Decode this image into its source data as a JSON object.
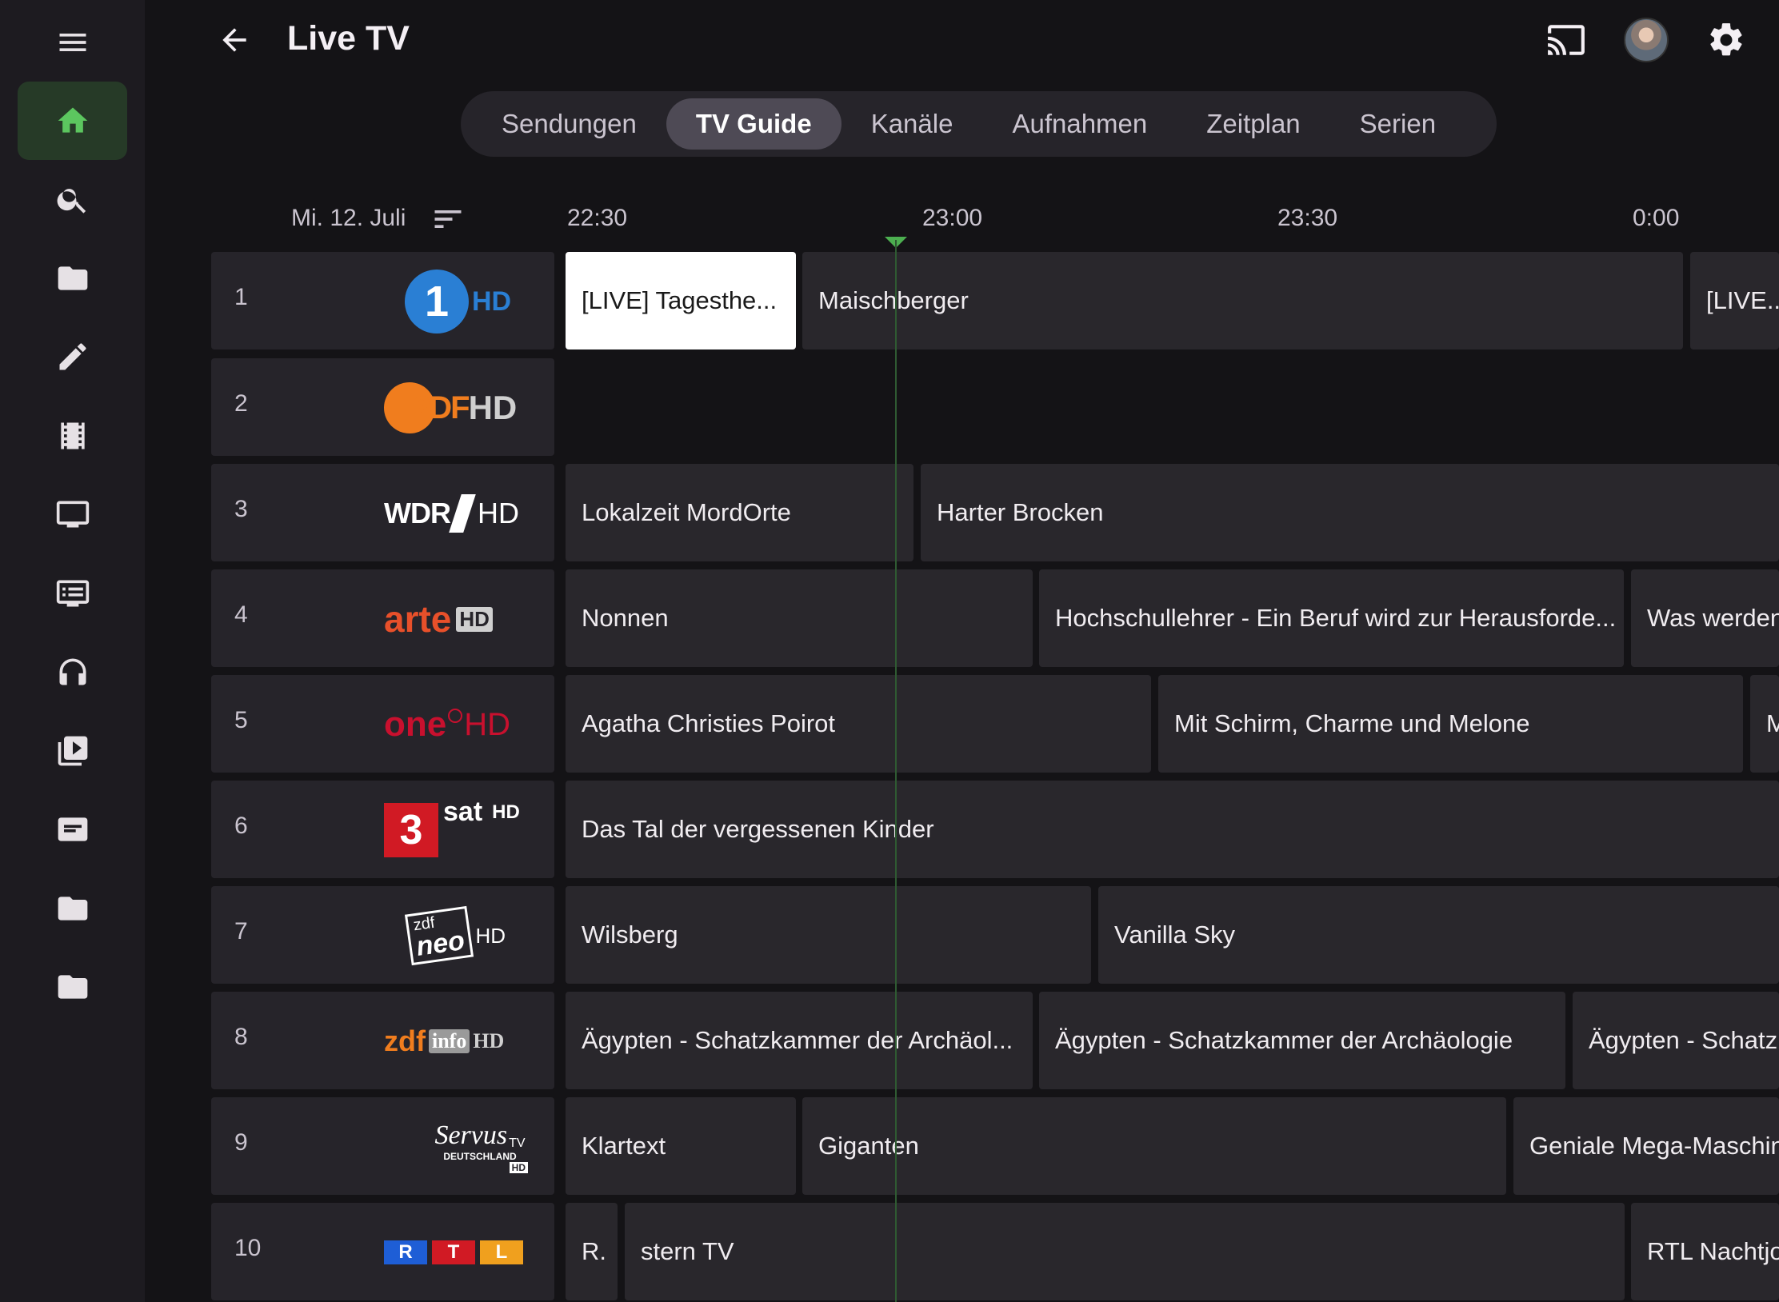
{
  "app": {
    "title": "Live TV"
  },
  "sidebar": {
    "items": [
      {
        "icon": "home-icon",
        "active": true
      },
      {
        "icon": "search-icon"
      },
      {
        "icon": "folder-icon"
      },
      {
        "icon": "pencil-icon"
      },
      {
        "icon": "film-icon"
      },
      {
        "icon": "tv-icon"
      },
      {
        "icon": "list-icon"
      },
      {
        "icon": "headphones-icon"
      },
      {
        "icon": "video-library-icon"
      },
      {
        "icon": "document-icon"
      },
      {
        "icon": "folder-icon"
      },
      {
        "icon": "folder-icon"
      }
    ],
    "active_color": "#4caf50"
  },
  "tabs": [
    {
      "label": "Sendungen"
    },
    {
      "label": "TV Guide",
      "active": true
    },
    {
      "label": "Kanäle"
    },
    {
      "label": "Aufnahmen"
    },
    {
      "label": "Zeitplan"
    },
    {
      "label": "Serien"
    }
  ],
  "guide": {
    "date": "Mi. 12. Juli",
    "times": [
      "22:30",
      "23:00",
      "23:30",
      "0:00"
    ],
    "now_color": "#4caf50",
    "channels": [
      {
        "number": "1",
        "logo": {
          "text": "1",
          "suffix": "HD",
          "color": "#1e73be"
        },
        "programs": [
          "[LIVE] Tagesthe...",
          "Maischberger",
          "[LIVE..."
        ]
      },
      {
        "number": "2",
        "logo": {
          "text": "2DF",
          "suffix": "HD",
          "color": "#f07d1e"
        },
        "programs": []
      },
      {
        "number": "3",
        "logo": {
          "text": "WDR",
          "suffix": "HD",
          "color": "#ffffff"
        },
        "programs": [
          "Lokalzeit MordOrte",
          "Harter Brocken"
        ]
      },
      {
        "number": "4",
        "logo": {
          "text": "arte",
          "suffix": "HD",
          "color": "#e8502a"
        },
        "programs": [
          "Nonnen",
          "Hochschullehrer - Ein Beruf wird zur Herausforde...",
          "Was werden"
        ]
      },
      {
        "number": "5",
        "logo": {
          "text": "one",
          "suffix": "HD",
          "color": "#c8102e"
        },
        "programs": [
          "Agatha Christies Poirot",
          "Mit Schirm, Charme und Melone",
          "M"
        ]
      },
      {
        "number": "6",
        "logo": {
          "text": "3",
          "mid": "sat",
          "suffix": "HD",
          "color": "#d11a24"
        },
        "programs": [
          "Das Tal der vergessenen Kinder"
        ]
      },
      {
        "number": "7",
        "logo": {
          "text": "zdf",
          "mid": "neo",
          "suffix": "HD",
          "color": "#ffffff"
        },
        "programs": [
          "Wilsberg",
          "Vanilla Sky"
        ]
      },
      {
        "number": "8",
        "logo": {
          "text": "zdf",
          "mid": "info",
          "suffix": "HD",
          "color": "#f07d1e"
        },
        "programs": [
          "Ägypten - Schatzkammer der Archäol...",
          "Ägypten - Schatzkammer der Archäologie",
          "Ägypten - Schatzl"
        ]
      },
      {
        "number": "9",
        "logo": {
          "text": "Servus",
          "mid": "TV",
          "sub": "DEUTSCHLAND",
          "suffix": "HD",
          "color": "#ffffff"
        },
        "programs": [
          "Klartext",
          "Giganten",
          "Geniale Mega-Maschin"
        ]
      },
      {
        "number": "10",
        "logo": {
          "text": "R",
          "mid": "T",
          "sub": "L",
          "color": "#1e5ed6"
        },
        "programs": [
          "R.",
          "stern TV",
          "RTL Nachtjo"
        ]
      }
    ]
  }
}
